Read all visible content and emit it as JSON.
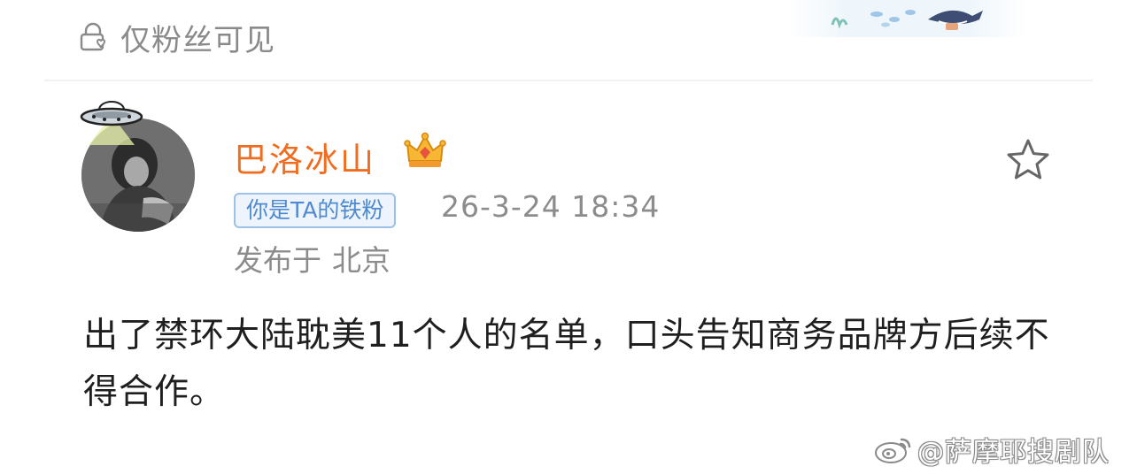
{
  "visibility": {
    "icon": "lock-heart-icon",
    "label": "仅粉丝可见"
  },
  "post": {
    "author": {
      "name": "巴洛冰山",
      "name_color": "#f06d1f",
      "badge_icon": "crown-icon",
      "avatar_ornament": "ufo-icon"
    },
    "fan_badge": "你是TA的铁粉",
    "time": "26-3-24 18:34",
    "location_prefix": "发布于",
    "location": "北京",
    "favorite_icon": "star-icon",
    "content": "出了禁环大陆耽美11个人的名单，口头告知商务品牌方后续不得合作。"
  },
  "watermark": {
    "icon": "weibo-logo-icon",
    "text": "@萨摩耶搜剧队"
  },
  "colors": {
    "accent_orange": "#f06d1f",
    "badge_blue": "#4f8ad1",
    "muted_gray": "#8c8c8c"
  }
}
